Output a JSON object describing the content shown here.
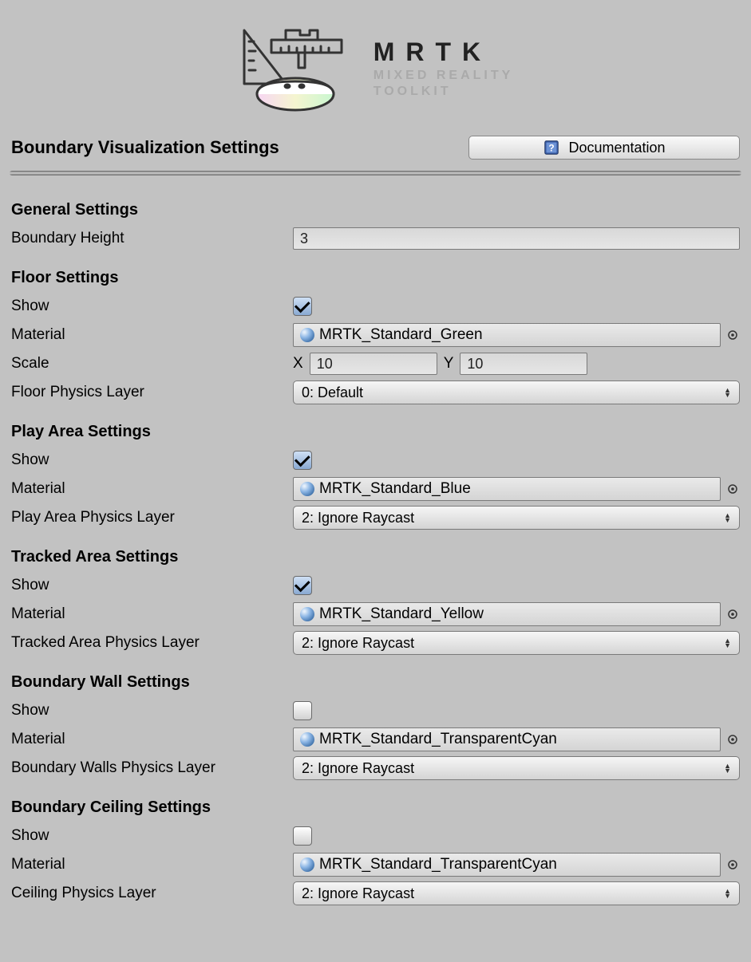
{
  "logo": {
    "title": "MRTK",
    "sub1": "MIXED REALITY",
    "sub2": "TOOLKIT"
  },
  "page_title": "Boundary Visualization Settings",
  "documentation_label": "Documentation",
  "general": {
    "heading": "General Settings",
    "boundary_height_label": "Boundary Height",
    "boundary_height_value": "3"
  },
  "floor": {
    "heading": "Floor Settings",
    "show_label": "Show",
    "show_checked": true,
    "material_label": "Material",
    "material_value": "MRTK_Standard_Green",
    "scale_label": "Scale",
    "scale_x_label": "X",
    "scale_x_value": "10",
    "scale_y_label": "Y",
    "scale_y_value": "10",
    "physics_label": "Floor Physics Layer",
    "physics_value": "0: Default"
  },
  "play_area": {
    "heading": "Play Area Settings",
    "show_label": "Show",
    "show_checked": true,
    "material_label": "Material",
    "material_value": "MRTK_Standard_Blue",
    "physics_label": "Play Area Physics Layer",
    "physics_value": "2: Ignore Raycast"
  },
  "tracked_area": {
    "heading": "Tracked Area Settings",
    "show_label": "Show",
    "show_checked": true,
    "material_label": "Material",
    "material_value": "MRTK_Standard_Yellow",
    "physics_label": "Tracked Area Physics Layer",
    "physics_value": "2: Ignore Raycast"
  },
  "boundary_wall": {
    "heading": "Boundary Wall Settings",
    "show_label": "Show",
    "show_checked": false,
    "material_label": "Material",
    "material_value": "MRTK_Standard_TransparentCyan",
    "physics_label": "Boundary Walls Physics Layer",
    "physics_value": "2: Ignore Raycast"
  },
  "boundary_ceiling": {
    "heading": "Boundary Ceiling Settings",
    "show_label": "Show",
    "show_checked": false,
    "material_label": "Material",
    "material_value": "MRTK_Standard_TransparentCyan",
    "physics_label": "Ceiling Physics Layer",
    "physics_value": "2: Ignore Raycast"
  }
}
